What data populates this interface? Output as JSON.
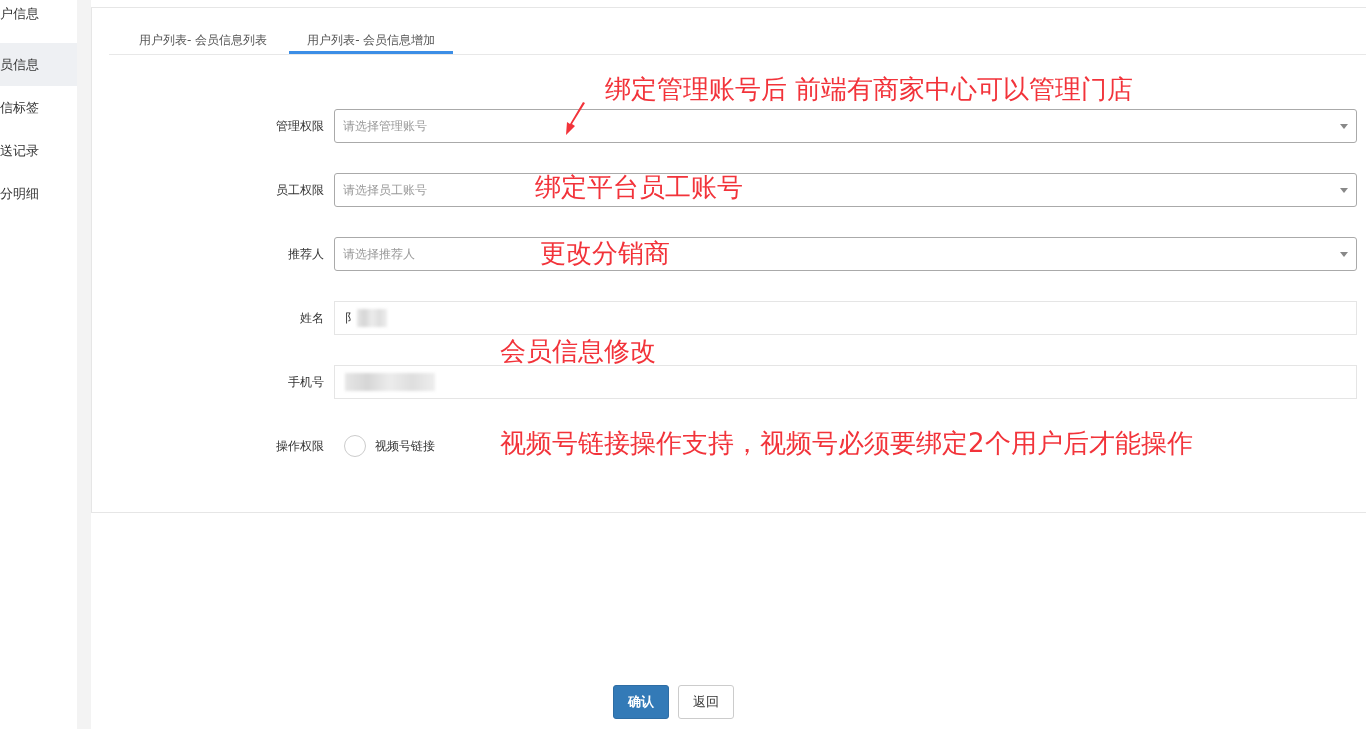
{
  "sidebar": {
    "items": [
      {
        "label": "户信息",
        "selected": false
      },
      {
        "label": "员信息",
        "selected": true
      },
      {
        "label": "信标签",
        "selected": false
      },
      {
        "label": "送记录",
        "selected": false
      },
      {
        "label": "分明细",
        "selected": false
      }
    ]
  },
  "tabs": [
    {
      "label": "用户列表- 会员信息列表",
      "selected": false
    },
    {
      "label": "用户列表- 会员信息增加",
      "selected": true
    }
  ],
  "form": {
    "fields": [
      {
        "kind": "select",
        "label": "管理权限",
        "placeholder": "请选择管理账号"
      },
      {
        "kind": "select",
        "label": "员工权限",
        "placeholder": "请选择员工账号"
      },
      {
        "kind": "select",
        "label": "推荐人",
        "placeholder": "请选择推荐人"
      },
      {
        "kind": "text",
        "label": "姓名",
        "value": "阝",
        "redacted": true
      },
      {
        "kind": "text",
        "label": "手机号",
        "redacted": true
      },
      {
        "kind": "radio",
        "label": "操作权限",
        "option": "视频号链接",
        "checked": false
      }
    ]
  },
  "annotations": [
    "绑定管理账号后 前端有商家中心可以管理门店",
    "绑定平台员工账号",
    "更改分销商",
    "会员信息修改",
    "视频号链接操作支持，视频号必须要绑定2个用户后才能操作"
  ],
  "buttons": [
    {
      "label": "确认",
      "kind": "primary"
    },
    {
      "label": "返回",
      "kind": "default"
    }
  ]
}
